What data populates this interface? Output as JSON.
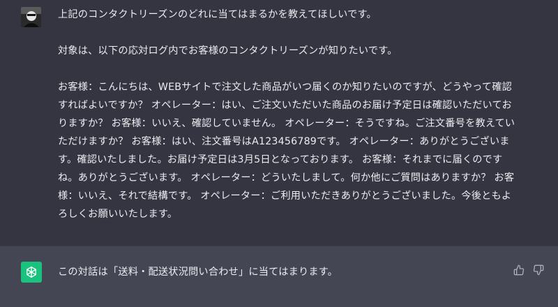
{
  "user_message": {
    "paragraphs": [
      "上記のコンタクトリーズンのどれに当てはまるかを教えてほしいです。",
      "対象は、以下の応対ログ内でお客様のコンタクトリーズンが知りたいです。",
      "お客様：こんにちは、WEBサイトで注文した商品がいつ届くのか知りたいのですが、どうやって確認すればよいですか？ オペレーター：はい、ご注文いただいた商品のお届け予定日は確認いただいておりますか？ お客様：いいえ、確認していません。 オペレーター：そうですね。ご注文番号を教えていただけますか？ お客様：はい、注文番号はA123456789です。 オペレーター：ありがとうございます。確認いたしました。お届け予定日は3月5日となっております。 お客様：それまでに届くのですね。ありがとうございます。 オペレーター：どういたしまして。何か他にご質問はありますか？ お客様：いいえ、それで結構です。 オペレーター：ご利用いただきありがとうございました。今後ともよろしくお願いいたします。"
    ]
  },
  "assistant_message": {
    "text": "この対話は「送料・配送状況問い合わせ」に当てはまります。"
  },
  "icons": {
    "user_avatar": "user-avatar-photo",
    "assistant_avatar": "chatgpt-logo-icon",
    "thumbs_up": "thumbs-up-icon",
    "thumbs_down": "thumbs-down-icon"
  },
  "colors": {
    "background": "#343541",
    "assistant_background": "#444654",
    "brand_green": "#19c37d",
    "text": "#ececf1",
    "icon_gray": "#acacbe"
  }
}
